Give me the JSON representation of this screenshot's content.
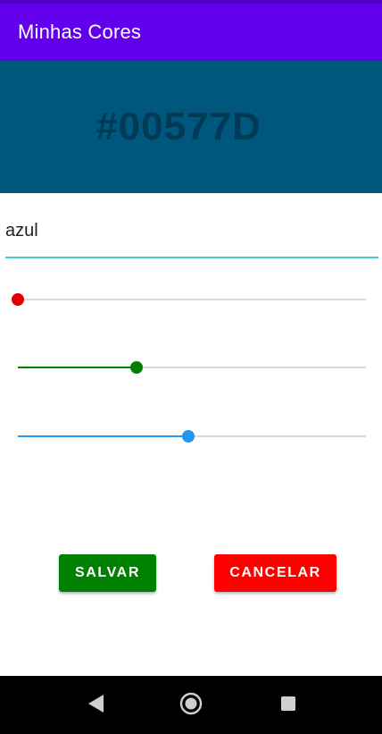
{
  "app": {
    "title": "Minhas Cores"
  },
  "preview": {
    "hex_label": "#00577D"
  },
  "name_field": {
    "value": "azul"
  },
  "sliders": {
    "red": {
      "value": 0,
      "max": 255
    },
    "green": {
      "value": 87,
      "max": 255
    },
    "blue": {
      "value": 125,
      "max": 255
    }
  },
  "buttons": {
    "save_label": "SALVAR",
    "cancel_label": "CANCELAR"
  },
  "colors": {
    "app_bar": "#6200ee",
    "status_strip": "#4f00c9",
    "preview_bg": "#00577D",
    "hex_text": "#003a55",
    "field_underline": "#3fd0d0",
    "red_thumb": "#e00000",
    "green_thumb": "#008000",
    "blue_thumb": "#2196f3",
    "save_button": "#008000",
    "cancel_button": "#ff0000",
    "nav_bar": "#000000",
    "nav_icons": "#cfcfcf"
  },
  "nav": {
    "back_icon": "back-triangle-icon",
    "home_icon": "home-circle-icon",
    "recent_icon": "recent-square-icon"
  }
}
